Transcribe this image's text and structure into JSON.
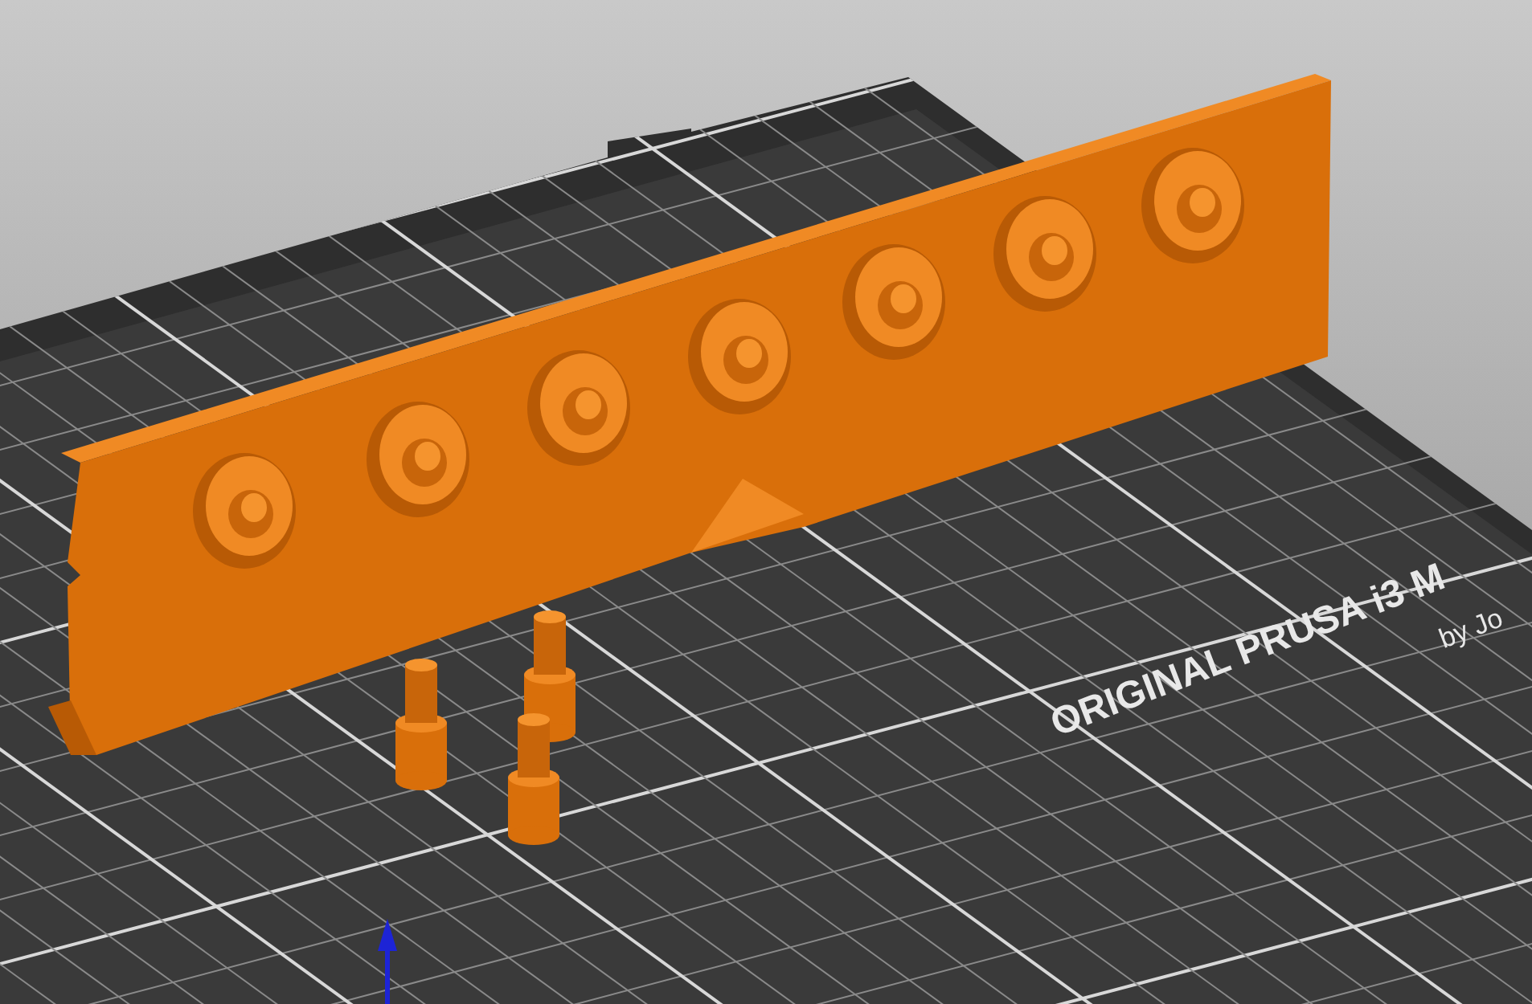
{
  "bed_label": {
    "title": "ORIGINAL PRUSA i3 M",
    "subtitle": "by Jo"
  }
}
